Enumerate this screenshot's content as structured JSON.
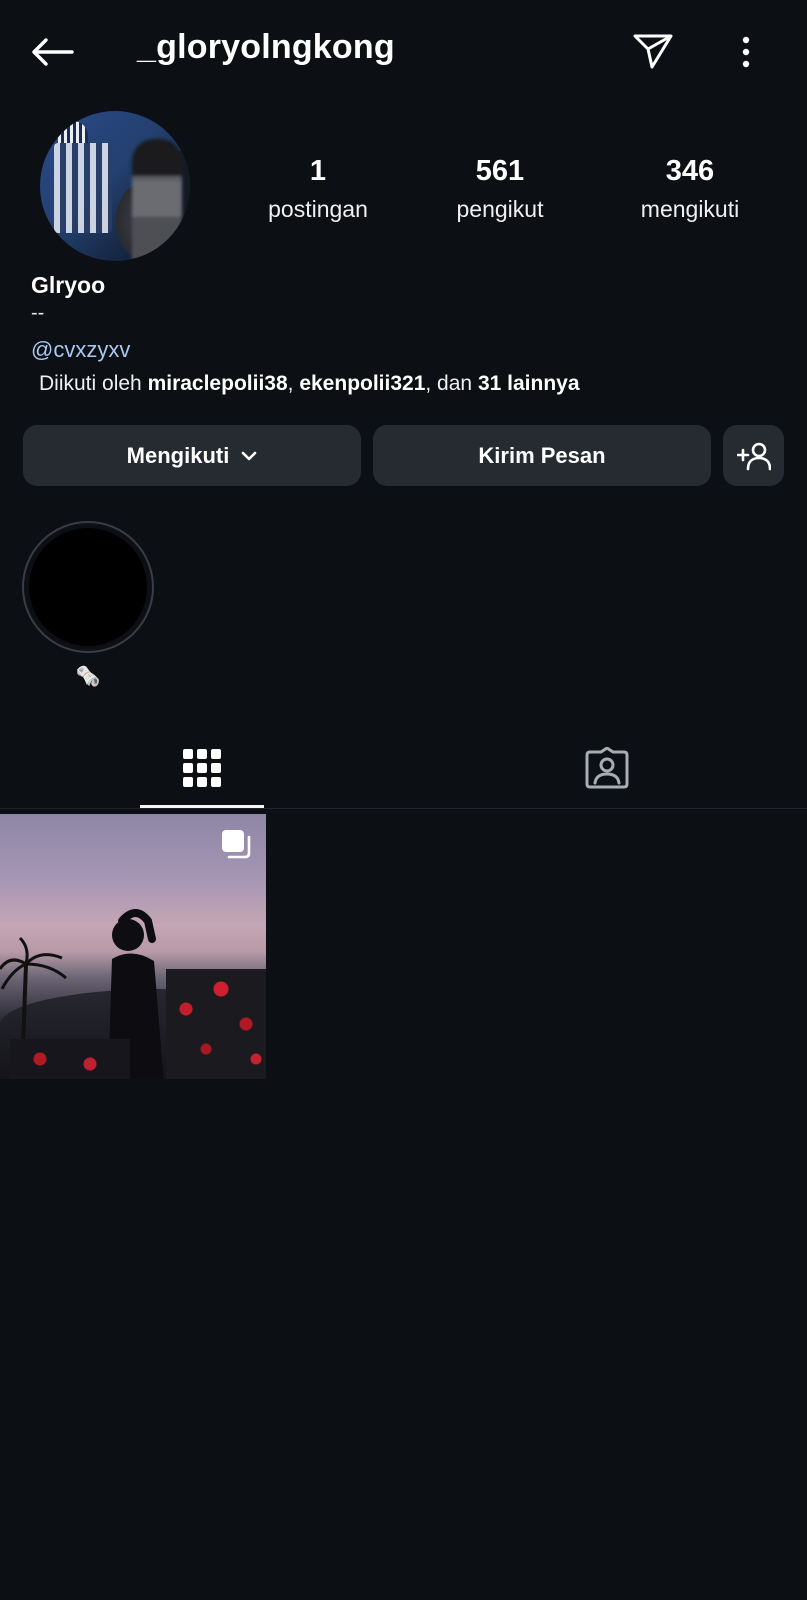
{
  "header": {
    "username": "_gloryolngkong"
  },
  "profile": {
    "display_name": "Glryoo",
    "bio_line": "--",
    "link": "@cvxzyxv",
    "stats": {
      "posts": {
        "value": "1",
        "label": "postingan"
      },
      "followers": {
        "value": "561",
        "label": "pengikut"
      },
      "following": {
        "value": "346",
        "label": "mengikuti"
      }
    },
    "followed_by": {
      "prefix": "Diikuti oleh",
      "user1": "miraclepolii38",
      "sep1": ",",
      "user2": "ekenpolii321",
      "sep2": ", dan",
      "others": "31 lainnya"
    }
  },
  "actions": {
    "following_label": "Mengikuti",
    "message_label": "Kirim Pesan"
  },
  "highlights": [
    {
      "label": "🗞️"
    }
  ],
  "icons": {
    "back": "arrow-left-icon",
    "send": "paper-plane-icon",
    "more": "kebab-menu-icon",
    "grid": "grid-icon",
    "tagged": "tagged-person-icon",
    "add_user": "add-user-icon",
    "chevron": "chevron-down-icon",
    "multi": "carousel-icon"
  },
  "colors": {
    "background": "#0c0f14",
    "button": "#262a31",
    "link": "#a8c8f0"
  }
}
